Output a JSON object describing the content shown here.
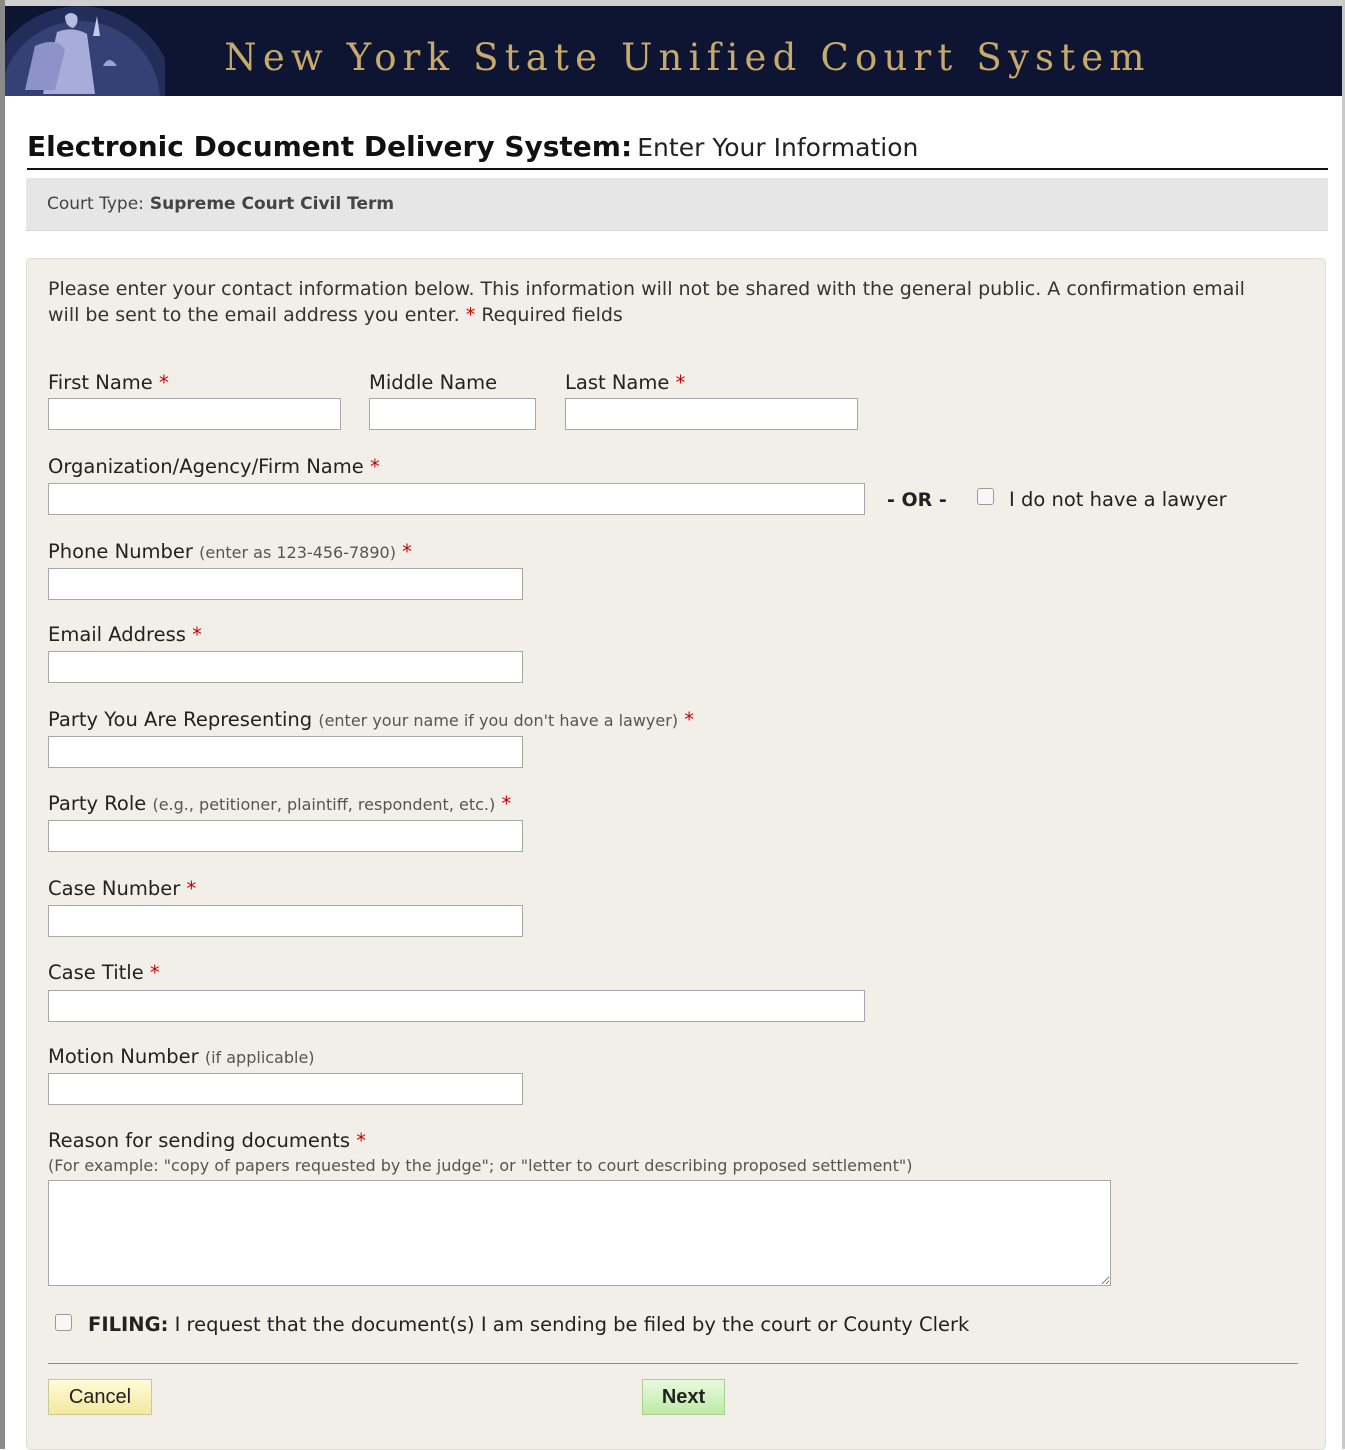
{
  "banner": {
    "title": "New York State Unified Court System"
  },
  "heading": {
    "bold": "Electronic Document Delivery System:",
    "normal": "Enter Your Information"
  },
  "court": {
    "label": "Court Type:",
    "value": "Supreme Court Civil Term"
  },
  "intro": {
    "text": "Please enter your contact information below. This information will not be shared with the general public. A confirmation email will be sent to the email address you enter.",
    "required_marker": "*",
    "required_text": "Required fields"
  },
  "fields": {
    "first_name": {
      "label": "First Name",
      "value": ""
    },
    "middle_name": {
      "label": "Middle Name",
      "value": ""
    },
    "last_name": {
      "label": "Last Name",
      "value": ""
    },
    "organization": {
      "label": "Organization/Agency/Firm Name",
      "value": ""
    },
    "or_text": "- OR -",
    "no_lawyer": {
      "label": "I do not have a lawyer",
      "checked": false
    },
    "phone": {
      "label": "Phone Number",
      "hint": "(enter as 123-456-7890)",
      "value": ""
    },
    "email": {
      "label": "Email Address",
      "value": ""
    },
    "party": {
      "label": "Party You Are Representing",
      "hint": "(enter your name if you don't have a lawyer)",
      "value": ""
    },
    "party_role": {
      "label": "Party Role",
      "hint": "(e.g., petitioner, plaintiff, respondent, etc.)",
      "value": ""
    },
    "case_number": {
      "label": "Case Number",
      "value": ""
    },
    "case_title": {
      "label": "Case Title",
      "value": ""
    },
    "motion_number": {
      "label": "Motion Number",
      "hint": "(if applicable)",
      "value": ""
    },
    "reason": {
      "label": "Reason for sending documents",
      "hint": "(For example: \"copy of papers requested by the judge\"; or \"letter to court describing proposed settlement\")",
      "value": ""
    }
  },
  "filing": {
    "bold": "FILING:",
    "text": "I request that the document(s) I am sending be filed by the court or County Clerk",
    "checked": false
  },
  "buttons": {
    "cancel": "Cancel",
    "next": "Next"
  },
  "colors": {
    "banner_bg": "#0d1533",
    "banner_text": "#c9a96a",
    "required": "#cc0000",
    "panel_bg": "#f2efe9"
  }
}
